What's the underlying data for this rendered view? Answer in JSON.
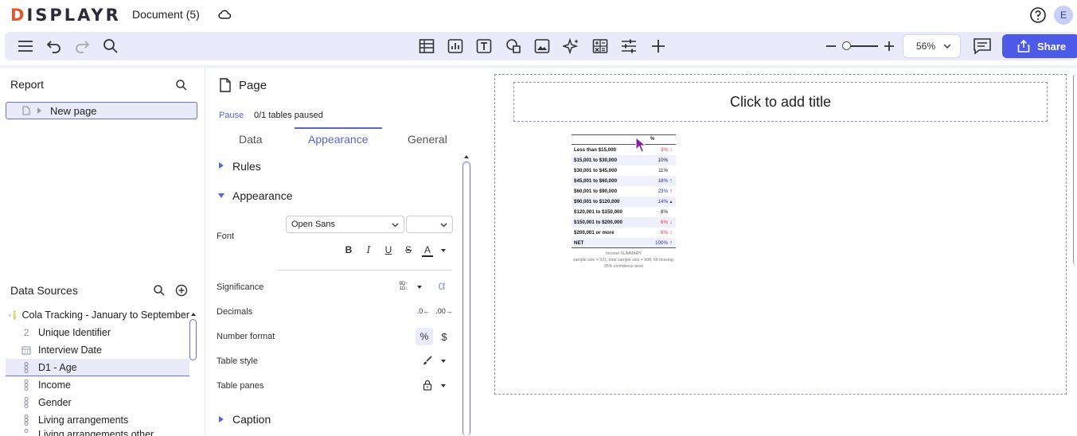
{
  "app": {
    "logo": "DISPLAYR",
    "document_title": "Document (5)",
    "user_initial": "E"
  },
  "toolbar": {
    "zoom_value": "56%",
    "share_label": "Share"
  },
  "report": {
    "title": "Report",
    "pages": [
      {
        "label": "New page"
      }
    ]
  },
  "data_sources": {
    "title": "Data Sources",
    "items": [
      {
        "label": "Cola Tracking - January to September",
        "icon": "database-icon"
      },
      {
        "label": "Unique Identifier",
        "icon": "numeric-icon",
        "glyph": "2"
      },
      {
        "label": "Interview Date",
        "icon": "calendar-icon"
      },
      {
        "label": "D1 - Age",
        "icon": "categorical-icon"
      },
      {
        "label": "Income",
        "icon": "categorical-icon"
      },
      {
        "label": "Gender",
        "icon": "categorical-icon"
      },
      {
        "label": "Living arrangements",
        "icon": "categorical-icon"
      },
      {
        "label": "Living arrangements other",
        "icon": "categorical-icon"
      }
    ]
  },
  "properties": {
    "title": "Page",
    "pause_label": "Pause",
    "paused_status": "0/1 tables paused",
    "tabs": [
      {
        "label": "Data"
      },
      {
        "label": "Appearance"
      },
      {
        "label": "General"
      }
    ],
    "active_tab": "Appearance",
    "sections": {
      "rules": "Rules",
      "appearance": "Appearance",
      "caption": "Caption"
    },
    "font_label": "Font",
    "font_value": "Open Sans",
    "font_size_value": "",
    "significance_label": "Significance",
    "decimals_label": "Decimals",
    "number_format_label": "Number format",
    "table_style_label": "Table style",
    "table_panes_label": "Table panes",
    "percent_symbol": "%",
    "dollar_symbol": "$",
    "alpha_symbol": "α"
  },
  "canvas": {
    "title_placeholder": "Click to add title",
    "table": {
      "column_header": "%",
      "rows": [
        {
          "label": "Less than $15,000",
          "value": "3%",
          "arrow": "down"
        },
        {
          "label": "$15,001 to $30,000",
          "value": "10%",
          "arrow": ""
        },
        {
          "label": "$30,001 to $45,000",
          "value": "11%",
          "arrow": ""
        },
        {
          "label": "$45,001 to $60,000",
          "value": "18%",
          "arrow": "up"
        },
        {
          "label": "$60,001 to $90,000",
          "value": "23%",
          "arrow": "up"
        },
        {
          "label": "$90,001 to $120,000",
          "value": "14%",
          "arrow": "up-small"
        },
        {
          "label": "$120,001 to $150,000",
          "value": "8%",
          "arrow": ""
        },
        {
          "label": "$150,001 to $200,000",
          "value": "6%",
          "arrow": "down"
        },
        {
          "label": "$200,001 or more",
          "value": "6%",
          "arrow": "down"
        },
        {
          "label": "NET",
          "value": "100%",
          "arrow": "up"
        }
      ],
      "footer_line1": "Income SUMMARY",
      "footer_line2": "sample size = 531; total sample size = 600; 69 missing; 95% confidence level"
    }
  },
  "colors": {
    "accent": "#4d5ae8",
    "toolbar_bg": "#e9ebfb",
    "up_arrow": "#2233aa",
    "down_arrow": "#d83a3a"
  }
}
